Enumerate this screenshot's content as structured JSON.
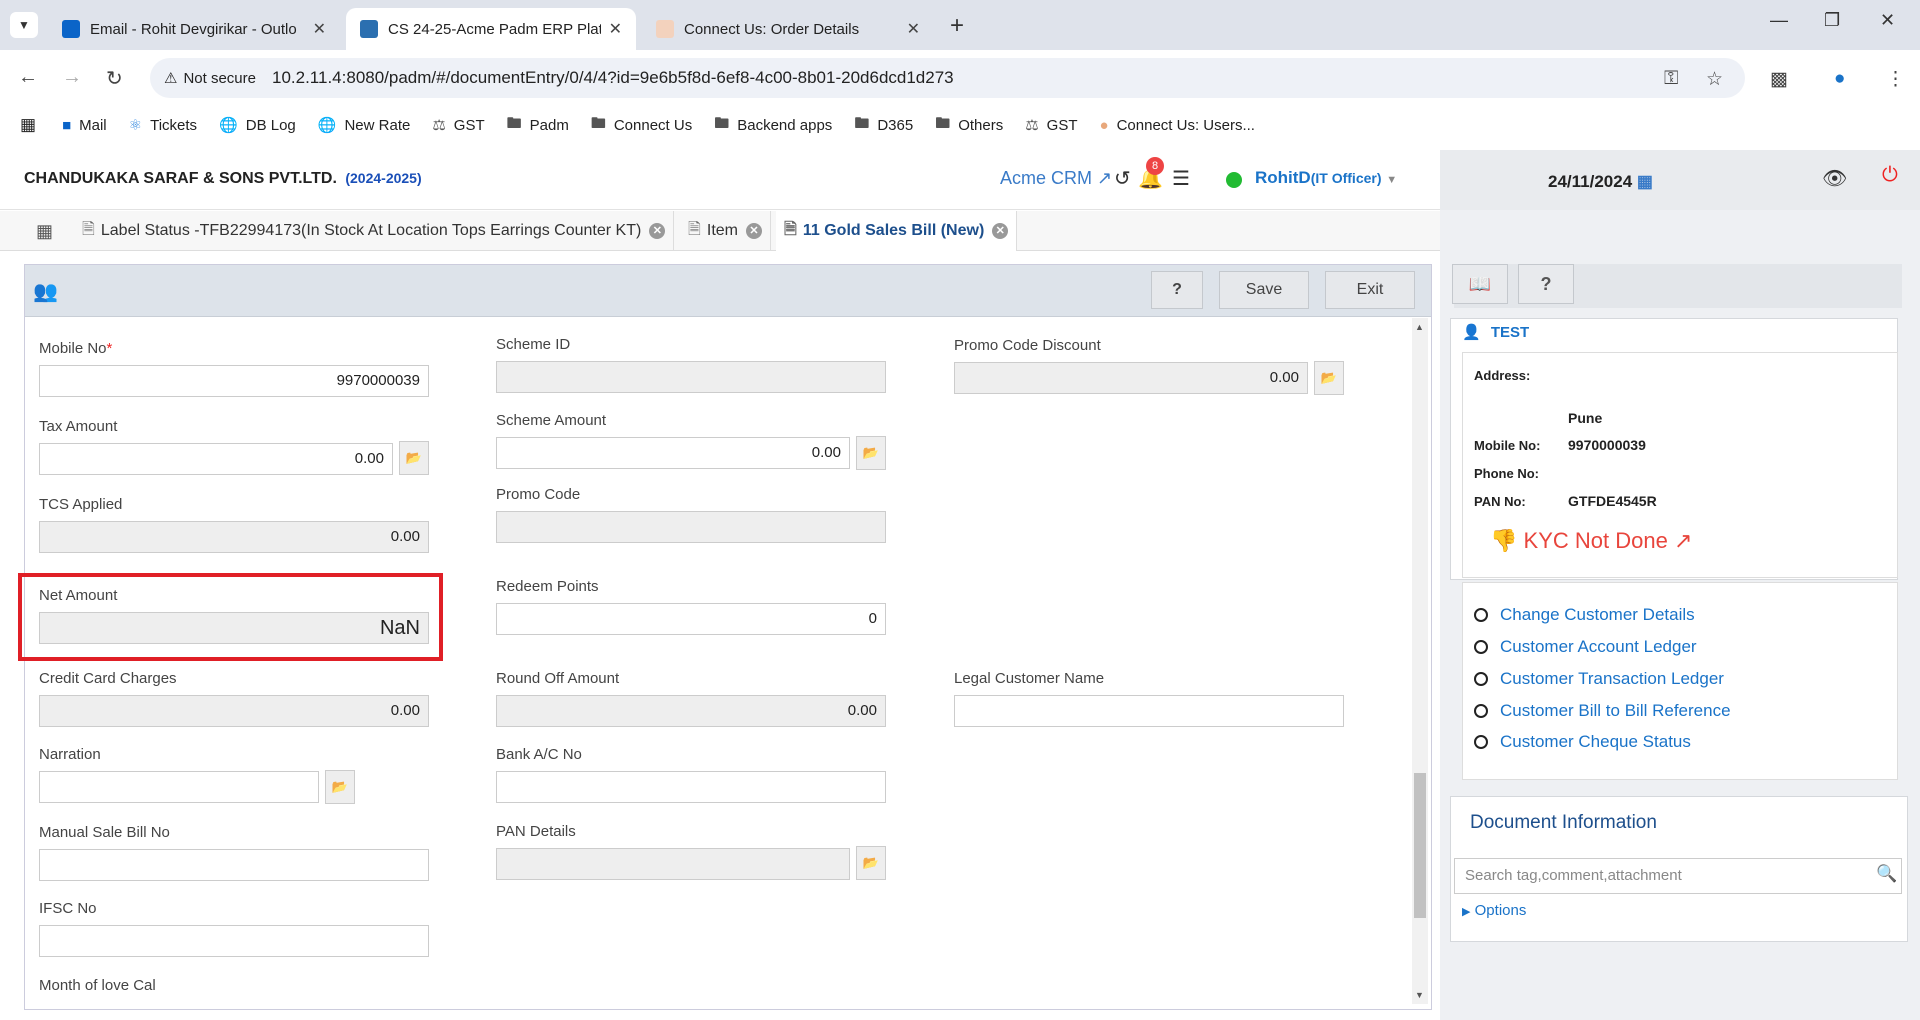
{
  "browser": {
    "tabs": [
      {
        "title": "Email - Rohit Devgirikar - Outlo",
        "icon": "outlook-icon",
        "color": "#0a64c8"
      },
      {
        "title": "CS 24-25-Acme Padm ERP Platf",
        "icon": "erp-icon",
        "color": "#2b6fb0"
      },
      {
        "title": "Connect Us: Order Details",
        "icon": "connect-icon",
        "color": "#e8a87c"
      }
    ],
    "not_secure": "Not secure",
    "url": "10.2.11.4:8080/padm/#/documentEntry/0/4/4?id=9e6b5f8d-6ef8-4c00-8b01-20d6dcd1d273",
    "bookmarks": [
      {
        "label": "Mail",
        "icon": "outlook-icon"
      },
      {
        "label": "Tickets",
        "icon": "react-icon"
      },
      {
        "label": "DB Log",
        "icon": "globe-icon"
      },
      {
        "label": "New Rate",
        "icon": "globe-icon"
      },
      {
        "label": "GST",
        "icon": "gst-icon"
      },
      {
        "label": "Padm",
        "icon": "folder-icon"
      },
      {
        "label": "Connect Us",
        "icon": "folder-icon"
      },
      {
        "label": "Backend apps",
        "icon": "folder-icon"
      },
      {
        "label": "D365",
        "icon": "folder-icon"
      },
      {
        "label": "Others",
        "icon": "folder-icon"
      },
      {
        "label": "GST",
        "icon": "gst-icon"
      },
      {
        "label": "Connect Us: Users...",
        "icon": "connect-icon"
      }
    ]
  },
  "header": {
    "company": "CHANDUKAKA SARAF & SONS PVT.LTD.",
    "year": "(2024-2025)",
    "crm": "Acme CRM",
    "notif_count": "8",
    "user": "RohitD",
    "role": "(IT Officer)",
    "date": "24/11/2024"
  },
  "app_tabs": [
    {
      "label": "Label Status -TFB22994173(In Stock At Location Tops Earrings Counter KT)"
    },
    {
      "label": "Item"
    },
    {
      "label": "11 Gold Sales Bill (New)"
    }
  ],
  "toolbar": {
    "help": "?",
    "save": "Save",
    "exit": "Exit"
  },
  "form": {
    "mobile_no": {
      "label": "Mobile No",
      "required": "*",
      "value": "9970000039"
    },
    "tax_amount": {
      "label": "Tax Amount",
      "value": "0.00"
    },
    "tcs_applied": {
      "label": "TCS Applied",
      "value": "0.00"
    },
    "net_amount": {
      "label": "Net Amount",
      "value": "NaN"
    },
    "credit_card_charges": {
      "label": "Credit Card Charges",
      "value": "0.00"
    },
    "narration": {
      "label": "Narration",
      "value": ""
    },
    "manual_sale_bill_no": {
      "label": "Manual Sale Bill No",
      "value": ""
    },
    "ifsc_no": {
      "label": "IFSC No",
      "value": ""
    },
    "month_of_love_cal": {
      "label": "Month of love Cal"
    },
    "scheme_id": {
      "label": "Scheme ID",
      "value": ""
    },
    "scheme_amount": {
      "label": "Scheme Amount",
      "value": "0.00"
    },
    "promo_code": {
      "label": "Promo Code",
      "value": ""
    },
    "redeem_points": {
      "label": "Redeem Points",
      "value": "0"
    },
    "round_off_amount": {
      "label": "Round Off Amount",
      "value": "0.00"
    },
    "bank_ac_no": {
      "label": "Bank A/C No",
      "value": ""
    },
    "pan_details": {
      "label": "PAN Details",
      "value": ""
    },
    "promo_code_discount": {
      "label": "Promo Code Discount",
      "value": "0.00"
    },
    "legal_customer_name": {
      "label": "Legal Customer Name",
      "value": ""
    }
  },
  "customer": {
    "name": "TEST",
    "address_label": "Address:",
    "address_value": "Pune",
    "mobile_label": "Mobile No:",
    "mobile_value": "9970000039",
    "phone_label": "Phone No:",
    "pan_label": "PAN No:",
    "pan_value": "GTFDE4545R",
    "kyc": "KYC Not Done"
  },
  "customer_links": [
    "Change Customer Details",
    "Customer Account Ledger",
    "Customer Transaction Ledger",
    "Customer Bill to Bill Reference",
    "Customer Cheque Status"
  ],
  "doc_info": {
    "title": "Document Information",
    "search_placeholder": "Search tag,comment,attachment",
    "options": "Options"
  }
}
